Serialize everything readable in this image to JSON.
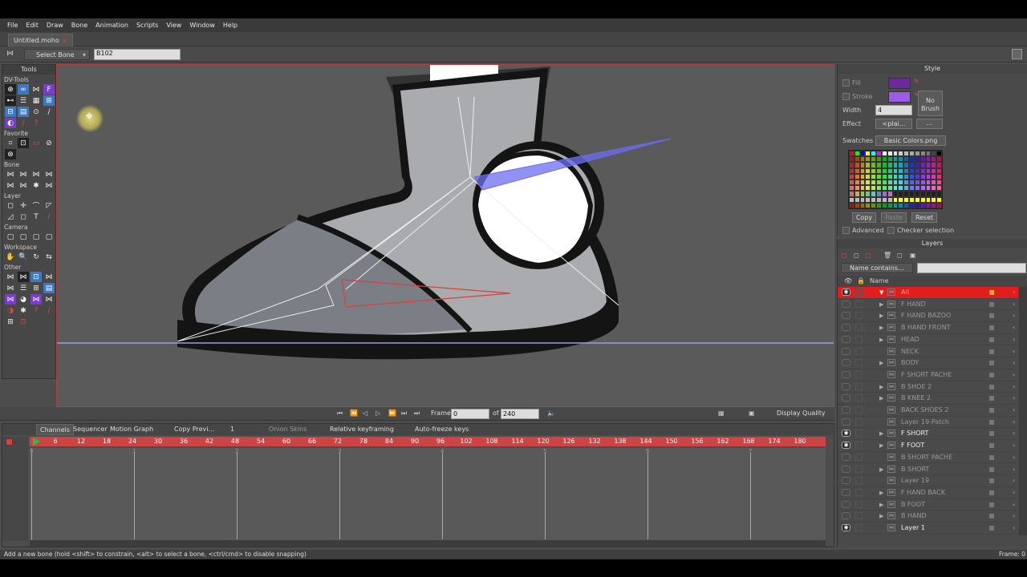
{
  "menu": [
    "File",
    "Edit",
    "Draw",
    "Bone",
    "Animation",
    "Scripts",
    "View",
    "Window",
    "Help"
  ],
  "doc_tab": {
    "label": "Untitled.moho",
    "close": "×"
  },
  "options_bar": {
    "tool_select": "Select Bone",
    "bone_name": "B102"
  },
  "tools": {
    "title": "Tools",
    "sections": [
      {
        "name": "DV-Tools",
        "icons": [
          "⊕",
          "F",
          "∞",
          "⋈",
          "⊷",
          "☰",
          "▦",
          "⊞",
          "⊟",
          "▤",
          "⊙",
          "∕",
          "?",
          "◐"
        ]
      },
      {
        "name": "Favorite",
        "icons": [
          "⌗",
          "⊡",
          "▭",
          "⊘",
          "⊛"
        ]
      },
      {
        "name": "Bone",
        "icons": [
          "⋈",
          "⋈",
          "⋈",
          "⋈",
          "⋈",
          "⋈",
          "✱",
          "⋈",
          "⋈"
        ]
      },
      {
        "name": "Layer",
        "icons": [
          "◻",
          "✛",
          "⌒",
          "◸",
          "◿",
          "◻",
          "T",
          "∕"
        ]
      },
      {
        "name": "Camera",
        "icons": [
          "▢",
          "▢",
          "▢",
          "▢"
        ]
      },
      {
        "name": "Workspace",
        "icons": [
          "✋",
          "🔍",
          "↻",
          "⇆"
        ]
      },
      {
        "name": "Other",
        "icons": [
          "⋈",
          "⋈",
          "⊡",
          "⋈",
          "⋈",
          "☰",
          "⊞",
          "▤",
          "⋈",
          "◕",
          "⋈",
          "⋈",
          "✱",
          "?",
          "◑",
          "⊞",
          "⊡",
          "∕"
        ]
      }
    ]
  },
  "playback": {
    "frame_label": "Frame",
    "frame_value": "0",
    "of_label": "of",
    "total_frames": "240",
    "display_quality": "Display Quality"
  },
  "timeline": {
    "tabs": [
      "Channels",
      "Sequencer",
      "Motion Graph"
    ],
    "copy_prev": "Copy Previ...",
    "copy_num": "1",
    "onion": "Onion Skins",
    "relative": "Relative keyframing",
    "autofreeze": "Auto-freeze keys",
    "ticks": [
      "6",
      "12",
      "18",
      "24",
      "30",
      "36",
      "42",
      "48",
      "54",
      "60",
      "66",
      "72",
      "78",
      "84",
      "90",
      "96",
      "102",
      "108",
      "114",
      "120",
      "126",
      "132",
      "138",
      "144",
      "150",
      "156",
      "162",
      "168",
      "174",
      "180"
    ],
    "sec_labels": [
      "0",
      "1",
      "2",
      "3",
      "4",
      "5",
      "6",
      "7"
    ]
  },
  "status": {
    "hint": "Add a new bone (hold <shift> to constrain, <alt> to select a bone, <ctrl/cmd> to disable snapping)",
    "frame": "Frame: 0"
  },
  "style_panel": {
    "title": "Style",
    "fill": "Fill",
    "stroke": "Stroke",
    "width_label": "Width",
    "width_value": "4",
    "effect_label": "Effect",
    "effect_value": "<plai...",
    "effect_more": "...",
    "no_brush": "No Brush",
    "swatches_label": "Swatches",
    "swatches_value": "Basic Colors.png",
    "copy": "Copy",
    "paste": "Paste",
    "reset": "Reset",
    "advanced": "Advanced",
    "checker": "Checker selection",
    "fill_color": "#6a2a9a",
    "stroke_color": "#9b5de5"
  },
  "layers_panel": {
    "title": "Layers",
    "filter": "Name contains...",
    "name_col": "Name",
    "rows": [
      {
        "name": "All",
        "selected": true,
        "arrow": "▼",
        "eye": true
      },
      {
        "name": "F HAND",
        "arrow": "▶"
      },
      {
        "name": "F HAND BAZOO",
        "arrow": "▶"
      },
      {
        "name": "B HAND FRONT",
        "arrow": "▶"
      },
      {
        "name": "HEAD",
        "arrow": "▶"
      },
      {
        "name": "NECK",
        "arrow": ""
      },
      {
        "name": "BODY",
        "arrow": "▶"
      },
      {
        "name": "F SHORT PACHE",
        "arrow": ""
      },
      {
        "name": "B SHOE 2",
        "arrow": "▶"
      },
      {
        "name": "B KNEE 2",
        "arrow": "▶"
      },
      {
        "name": "BACK SHOES 2",
        "arrow": ""
      },
      {
        "name": "Layer 19-Patch",
        "arrow": ""
      },
      {
        "name": "F SHORT",
        "arrow": "▶",
        "eye": true,
        "active": true
      },
      {
        "name": "F FOOT",
        "arrow": "▶",
        "eye": true,
        "active": true
      },
      {
        "name": "B SHORT PACHE",
        "arrow": ""
      },
      {
        "name": "B SHORT",
        "arrow": "▶"
      },
      {
        "name": "Layer 19",
        "arrow": ""
      },
      {
        "name": "F HAND BACK",
        "arrow": "▶"
      },
      {
        "name": "B FOOT",
        "arrow": "▶"
      },
      {
        "name": "B HAND",
        "arrow": "▶"
      },
      {
        "name": "Layer 1",
        "arrow": "",
        "eye": true,
        "active": true
      }
    ]
  }
}
